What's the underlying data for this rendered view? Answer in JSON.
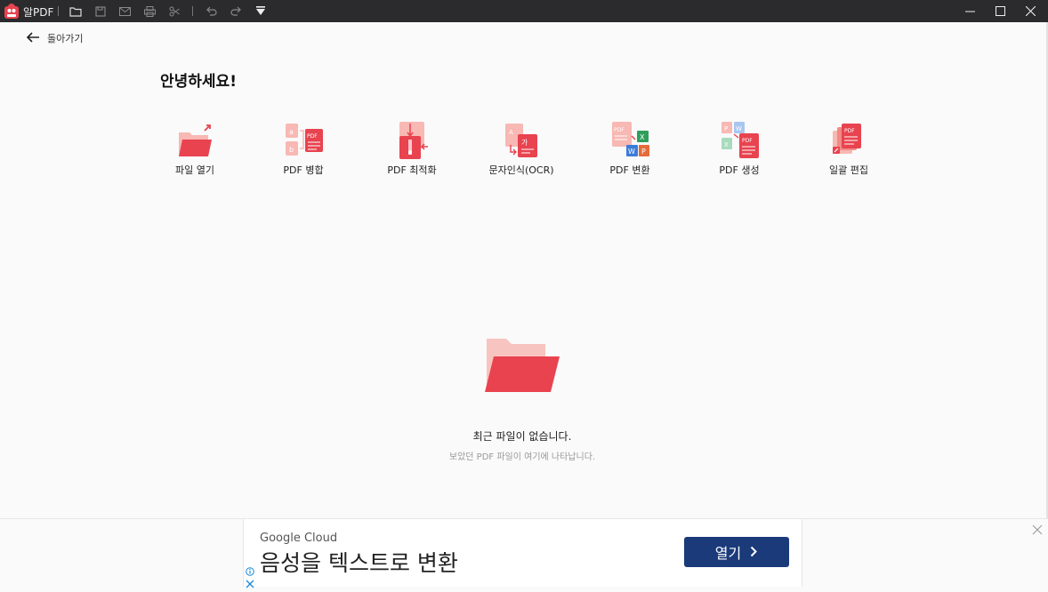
{
  "titlebar": {
    "app_name": "알PDF",
    "icons": [
      "folder-icon",
      "save-icon",
      "mail-icon",
      "print-icon",
      "scissors-icon",
      "undo-icon",
      "redo-icon",
      "dropdown-menu-icon"
    ],
    "window_controls": [
      "minimize-icon",
      "maximize-icon",
      "close-icon"
    ]
  },
  "back": {
    "label": "돌아가기"
  },
  "greeting": "안녕하세요!",
  "tools": [
    {
      "label": "파일 열기",
      "icon": "open-file-icon"
    },
    {
      "label": "PDF 병합",
      "icon": "merge-pdf-icon"
    },
    {
      "label": "PDF 최적화",
      "icon": "compress-pdf-icon"
    },
    {
      "label": "문자인식(OCR)",
      "icon": "ocr-icon"
    },
    {
      "label": "PDF 변환",
      "icon": "convert-pdf-icon"
    },
    {
      "label": "PDF 생성",
      "icon": "create-pdf-icon"
    },
    {
      "label": "일괄 편집",
      "icon": "batch-edit-icon"
    }
  ],
  "recent": {
    "title": "최근 파일이 없습니다.",
    "subtitle": "보았던 PDF 파일이 여기에 나타납니다."
  },
  "ad": {
    "brand": "Google Cloud",
    "headline": "음성을 텍스트로 변환",
    "button_label": "열기"
  },
  "colors": {
    "titlebar": "#2b2b2e",
    "accent_red": "#e8434f",
    "accent_pink": "#f8b8b3",
    "ad_button": "#1a3a7a"
  }
}
